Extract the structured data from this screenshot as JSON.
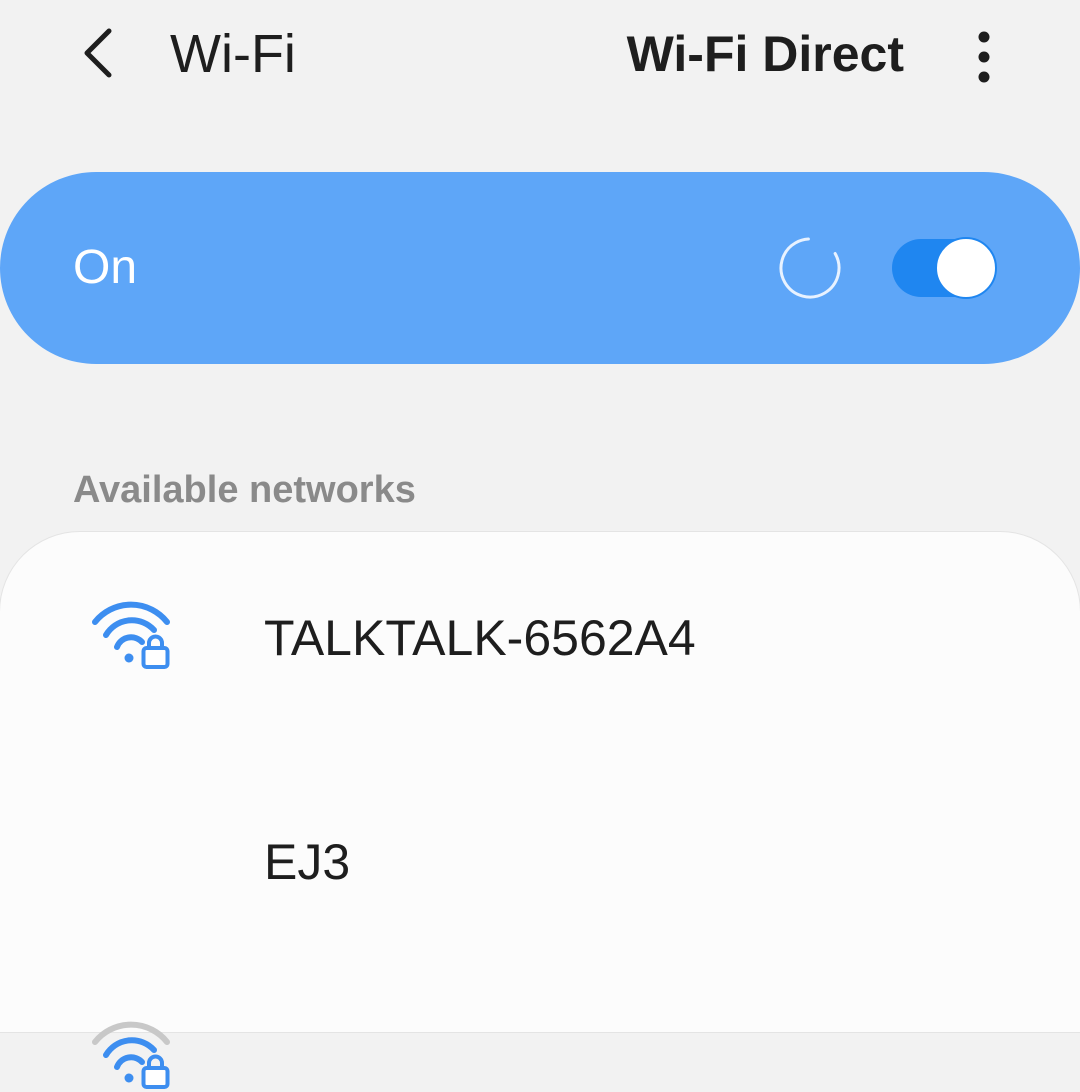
{
  "header": {
    "title": "Wi-Fi",
    "wifi_direct_label": "Wi-Fi Direct",
    "back_icon": "chevron-left-icon",
    "more_icon": "more-vertical-icon"
  },
  "master_toggle": {
    "label": "On",
    "state": "on",
    "scanning": true,
    "card_color": "#5ea6f8",
    "switch_track_color": "#1f86f0"
  },
  "available_section": {
    "label": "Available networks"
  },
  "networks": [
    {
      "name": "TALKTALK-6562A4",
      "secured": true,
      "signal_bars": 3,
      "icon": "wifi-lock-icon"
    },
    {
      "name": "EJ3",
      "secured": true,
      "signal_bars": 2,
      "icon": "wifi-lock-icon"
    }
  ],
  "colors": {
    "background": "#f2f2f2",
    "accent": "#3d8ef0",
    "weak_signal": "#c8c8c8"
  }
}
